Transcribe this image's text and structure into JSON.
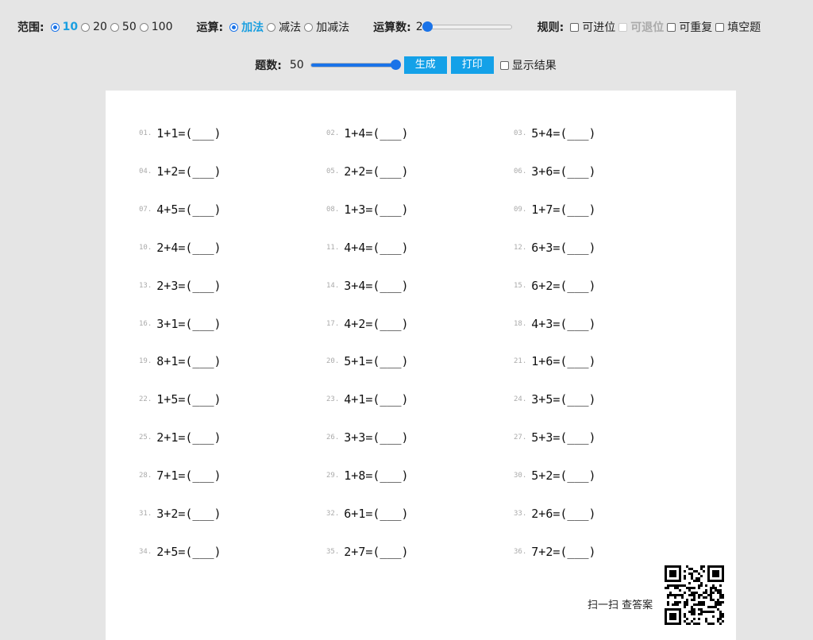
{
  "controls": {
    "range": {
      "label": "范围:",
      "options": [
        {
          "text": "10",
          "checked": true
        },
        {
          "text": "20",
          "checked": false
        },
        {
          "text": "50",
          "checked": false
        },
        {
          "text": "100",
          "checked": false
        }
      ]
    },
    "operation": {
      "label": "运算:",
      "options": [
        {
          "text": "加法",
          "checked": true
        },
        {
          "text": "减法",
          "checked": false
        },
        {
          "text": "加减法",
          "checked": false
        }
      ]
    },
    "operand_count": {
      "label": "运算数:",
      "value": "2",
      "slider_fraction": 0.0
    },
    "rules": {
      "label": "规则:",
      "options": [
        {
          "text": "可进位",
          "disabled": false
        },
        {
          "text": "可退位",
          "disabled": true
        },
        {
          "text": "可重复",
          "disabled": false
        },
        {
          "text": "填空题",
          "disabled": false
        }
      ]
    },
    "question_count": {
      "label": "题数:",
      "value": "50",
      "slider_fraction": 1.0
    },
    "generate_label": "生成",
    "print_label": "打印",
    "show_results_label": "显示结果"
  },
  "problems": [
    {
      "num": "01.",
      "expr": "1+1=(___)"
    },
    {
      "num": "02.",
      "expr": "1+4=(___)"
    },
    {
      "num": "03.",
      "expr": "5+4=(___)"
    },
    {
      "num": "04.",
      "expr": "1+2=(___)"
    },
    {
      "num": "05.",
      "expr": "2+2=(___)"
    },
    {
      "num": "06.",
      "expr": "3+6=(___)"
    },
    {
      "num": "07.",
      "expr": "4+5=(___)"
    },
    {
      "num": "08.",
      "expr": "1+3=(___)"
    },
    {
      "num": "09.",
      "expr": "1+7=(___)"
    },
    {
      "num": "10.",
      "expr": "2+4=(___)"
    },
    {
      "num": "11.",
      "expr": "4+4=(___)"
    },
    {
      "num": "12.",
      "expr": "6+3=(___)"
    },
    {
      "num": "13.",
      "expr": "2+3=(___)"
    },
    {
      "num": "14.",
      "expr": "3+4=(___)"
    },
    {
      "num": "15.",
      "expr": "6+2=(___)"
    },
    {
      "num": "16.",
      "expr": "3+1=(___)"
    },
    {
      "num": "17.",
      "expr": "4+2=(___)"
    },
    {
      "num": "18.",
      "expr": "4+3=(___)"
    },
    {
      "num": "19.",
      "expr": "8+1=(___)"
    },
    {
      "num": "20.",
      "expr": "5+1=(___)"
    },
    {
      "num": "21.",
      "expr": "1+6=(___)"
    },
    {
      "num": "22.",
      "expr": "1+5=(___)"
    },
    {
      "num": "23.",
      "expr": "4+1=(___)"
    },
    {
      "num": "24.",
      "expr": "3+5=(___)"
    },
    {
      "num": "25.",
      "expr": "2+1=(___)"
    },
    {
      "num": "26.",
      "expr": "3+3=(___)"
    },
    {
      "num": "27.",
      "expr": "5+3=(___)"
    },
    {
      "num": "28.",
      "expr": "7+1=(___)"
    },
    {
      "num": "29.",
      "expr": "1+8=(___)"
    },
    {
      "num": "30.",
      "expr": "5+2=(___)"
    },
    {
      "num": "31.",
      "expr": "3+2=(___)"
    },
    {
      "num": "32.",
      "expr": "6+1=(___)"
    },
    {
      "num": "33.",
      "expr": "2+6=(___)"
    },
    {
      "num": "34.",
      "expr": "2+5=(___)"
    },
    {
      "num": "35.",
      "expr": "2+7=(___)"
    },
    {
      "num": "36.",
      "expr": "7+2=(___)"
    }
  ],
  "qr_label": "扫一扫 查答案",
  "qr_icon": "qr-code-icon"
}
